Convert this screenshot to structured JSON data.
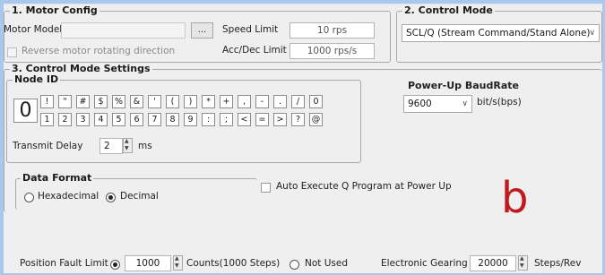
{
  "motor_config": {
    "title": "1. Motor Config",
    "motor_model_label": "Motor Model",
    "motor_model_value": "",
    "browse_label": "...",
    "reverse_label": "Reverse motor rotating direction",
    "speed_limit_label": "Speed Limit",
    "speed_limit_value": "10 rps",
    "acc_dec_label": "Acc/Dec Limit",
    "acc_dec_value": "1000 rps/s"
  },
  "control_mode": {
    "title": "2. Control Mode",
    "selected": "SCL/Q (Stream Command/Stand Alone)"
  },
  "settings": {
    "title": "3. Control Mode Settings",
    "node_id_label": "Node ID",
    "node_id_value": "0",
    "keys_row1": [
      "!",
      "\"",
      "#",
      "$",
      "%",
      "&",
      "'",
      "(",
      ")",
      "*",
      "+",
      ",",
      "-",
      ".",
      "/",
      "0"
    ],
    "keys_row2": [
      "1",
      "2",
      "3",
      "4",
      "5",
      "6",
      "7",
      "8",
      "9",
      ":",
      ";",
      "<",
      "=",
      ">",
      "?",
      "@"
    ],
    "transmit_delay_label": "Transmit Delay",
    "transmit_delay_value": "2",
    "transmit_delay_unit": "ms",
    "baud_label": "Power-Up BaudRate",
    "baud_value": "9600",
    "baud_unit": "bit/s(bps)",
    "data_format_label": "Data Format",
    "hex_label": "Hexadecimal",
    "dec_label": "Decimal",
    "data_format_selected": "Decimal",
    "auto_exec_label": "Auto Execute Q Program at Power Up",
    "pos_fault_label": "Position Fault Limit",
    "pos_fault_value": "1000",
    "pos_fault_unit": "Counts(1000 Steps)",
    "not_used_label": "Not Used",
    "gearing_label": "Electronic Gearing",
    "gearing_value": "20000",
    "gearing_unit": "Steps/Rev"
  },
  "overlay_letter": "b",
  "colors": {
    "background": "#a9c8ec",
    "panel": "#efefef",
    "overlay": "#c0191f"
  }
}
